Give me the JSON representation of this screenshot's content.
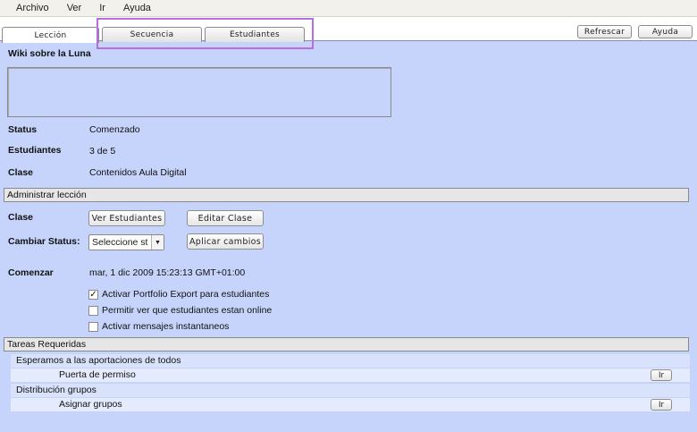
{
  "menu": {
    "items": [
      "Archivo",
      "Ver",
      "Ir",
      "Ayuda"
    ]
  },
  "tabs": [
    {
      "label": "Lección",
      "active": true
    },
    {
      "label": "Secuencia",
      "active": false
    },
    {
      "label": "Estudiantes",
      "active": false
    }
  ],
  "toolbar": {
    "refresh_label": "Refrescar",
    "help_label": "Ayuda"
  },
  "lesson": {
    "title": "Wiki sobre la Luna",
    "description": "",
    "status_label": "Status",
    "status_value": "Comenzado",
    "students_label": "Estudiantes",
    "students_value": "3 de 5",
    "class_label": "Clase",
    "class_value": "Contenidos Aula Digital"
  },
  "admin": {
    "section_title": "Administrar lección",
    "class_label": "Clase",
    "view_students_label": "Ver Estudiantes",
    "edit_class_label": "Editar Clase",
    "change_status_label": "Cambiar Status:",
    "status_select_value": "Seleccione st",
    "apply_changes_label": "Aplicar cambios",
    "start_label": "Comenzar",
    "start_value": "mar, 1 dic 2009 15:23:13 GMT+01:00",
    "options": [
      {
        "label": "Activar Portfolio Export para estudiantes",
        "checked": true
      },
      {
        "label": "Permitir ver que estudiantes estan online",
        "checked": false
      },
      {
        "label": "Activar mensajes instantaneos",
        "checked": false
      }
    ]
  },
  "tasks": {
    "section_title": "Tareas Requeridas",
    "go_label": "Ir",
    "groups": [
      {
        "label": "Esperamos a las aportaciones de todos",
        "item": "Puerta de permiso"
      },
      {
        "label": "Distribución grupos",
        "item": "Asignar grupos"
      }
    ]
  },
  "colors": {
    "background": "#c6d4fb",
    "highlight": "#b56de0"
  }
}
